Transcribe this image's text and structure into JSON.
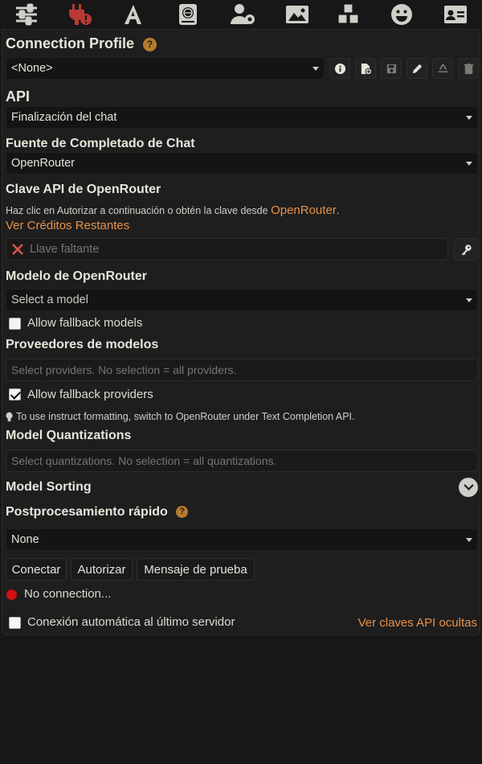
{
  "toolbar": {
    "icons": [
      "sliders-icon",
      "plug-error-icon",
      "font-icon",
      "book-globe-icon",
      "user-gear-icon",
      "image-icon",
      "cubes-icon",
      "smiley-icon",
      "id-card-icon"
    ],
    "active_color": "#b93a32",
    "icon_color": "#cfcfc8"
  },
  "connection_profile": {
    "title": "Connection Profile",
    "help": "?",
    "selected": "<None>"
  },
  "api": {
    "label": "API",
    "selected": "Finalización del chat"
  },
  "chat_source": {
    "label": "Fuente de Completado de Chat",
    "selected": "OpenRouter"
  },
  "api_key": {
    "label": "Clave API de OpenRouter",
    "hint_text": "Haz clic en Autorizar a continuación o obtén la clave desde ",
    "hint_link": "OpenRouter",
    "hint_end": ".",
    "credits_link": "Ver Créditos Restantes",
    "placeholder": "Llave faltante"
  },
  "model": {
    "label": "Modelo de OpenRouter",
    "selected": "Select a model",
    "fallback_models": "Allow fallback models"
  },
  "providers": {
    "label": "Proveedores de modelos",
    "placeholder": "Select providers. No selection = all providers.",
    "fallback_providers": "Allow fallback providers",
    "tip": "To use instruct formatting, switch to OpenRouter under Text Completion API."
  },
  "quantizations": {
    "label": "Model Quantizations",
    "placeholder": "Select quantizations. No selection = all quantizations."
  },
  "sorting": {
    "label": "Model Sorting"
  },
  "postprocessing": {
    "label": "Postprocesamiento rápido",
    "help": "?",
    "selected": "None"
  },
  "buttons": {
    "connect": "Conectar",
    "authorize": "Autorizar",
    "test": "Mensaje de prueba"
  },
  "status": {
    "text": "No connection...",
    "color": "#d01010"
  },
  "auto_connect": {
    "label": "Conexión automática al último servidor",
    "hidden_keys": "Ver claves API ocultas"
  }
}
